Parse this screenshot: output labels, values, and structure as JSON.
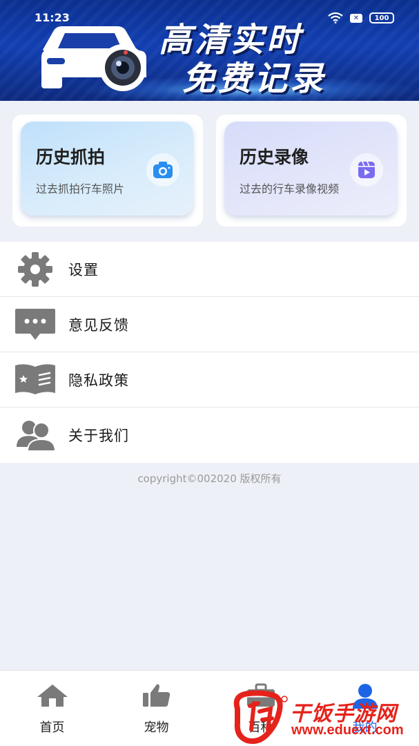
{
  "status_bar": {
    "time": "11:23",
    "battery": "100"
  },
  "banner": {
    "line1": "高清实时",
    "line2": "免费记录"
  },
  "cards": [
    {
      "title": "历史抓拍",
      "subtitle": "过去抓拍行车照片",
      "icon": "camera-icon",
      "color": "#2a8ef0"
    },
    {
      "title": "历史录像",
      "subtitle": "过去的行车录像视频",
      "icon": "video-icon",
      "color": "#7a6cf0"
    }
  ],
  "menu": [
    {
      "label": "设置",
      "icon": "gear-icon"
    },
    {
      "label": "意见反馈",
      "icon": "chat-icon"
    },
    {
      "label": "隐私政策",
      "icon": "book-icon"
    },
    {
      "label": "关于我们",
      "icon": "users-icon"
    }
  ],
  "copyright": "copyright©002020 版权所有",
  "bottom_nav": [
    {
      "label": "首页",
      "icon": "home-icon"
    },
    {
      "label": "宠物",
      "icon": "thumbs-up-icon"
    },
    {
      "label": "百科",
      "icon": "briefcase-icon"
    },
    {
      "label": "我的",
      "icon": "user-icon",
      "active": true
    }
  ],
  "watermark": {
    "name": "干饭手游网",
    "url": "www.eduext.com"
  },
  "colors": {
    "accent": "#1e64e6",
    "icon_gray": "#7a7a7a",
    "watermark": "#e5231b"
  }
}
